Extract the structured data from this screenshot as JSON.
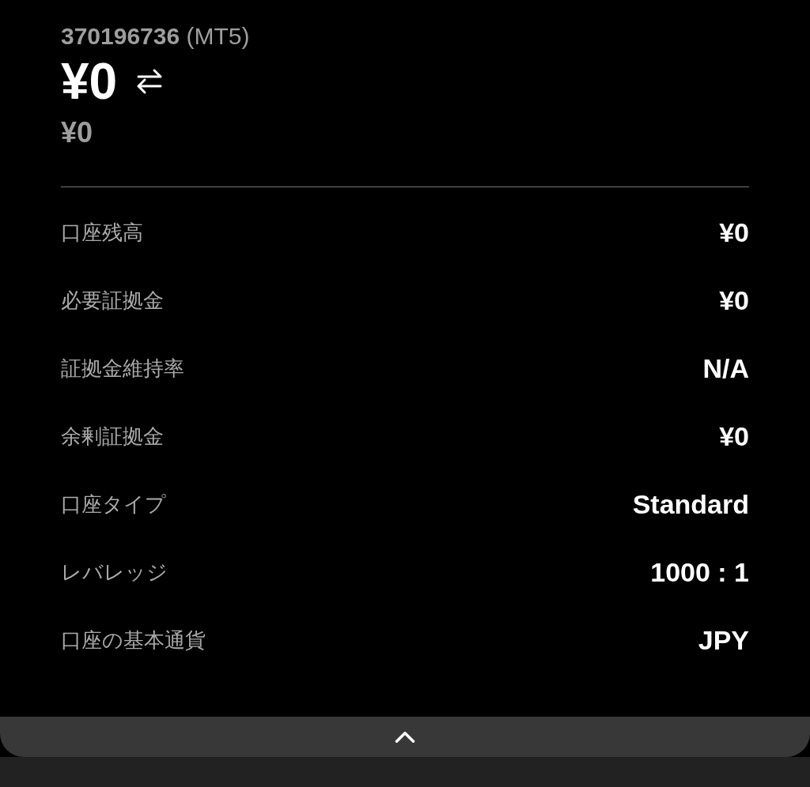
{
  "account": {
    "number": "370196736",
    "platform": "(MT5)"
  },
  "equity": "¥0",
  "sub_amount": "¥0",
  "details": [
    {
      "label": "口座残高",
      "value": "¥0"
    },
    {
      "label": "必要証拠金",
      "value": "¥0"
    },
    {
      "label": "証拠金維持率",
      "value": "N/A"
    },
    {
      "label": "余剰証拠金",
      "value": "¥0"
    },
    {
      "label": "口座タイプ",
      "value": "Standard"
    },
    {
      "label": "レバレッジ",
      "value": "1000 : 1"
    },
    {
      "label": "口座の基本通貨",
      "value": "JPY"
    }
  ],
  "bottom_bar": {
    "expanded": false
  }
}
